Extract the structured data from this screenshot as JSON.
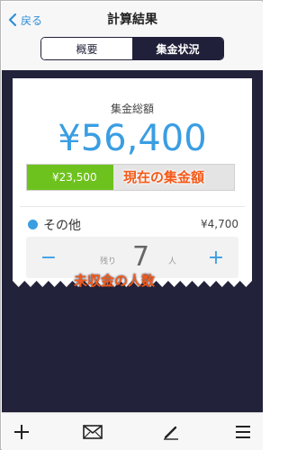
{
  "nav": {
    "back_label": "戻る",
    "title": "計算結果"
  },
  "tabs": [
    {
      "label": "概要",
      "selected": false
    },
    {
      "label": "集金状況",
      "selected": true
    }
  ],
  "summary": {
    "total_label": "集金総額",
    "total_amount": "¥56,400",
    "collected_amount": "¥23,500",
    "collected_fraction": 0.417
  },
  "annotations": {
    "current": "現在の集金額",
    "unpaid": "未収金の人数"
  },
  "member": {
    "name": "その他",
    "amount": "¥4,700",
    "remaining_label": "残り",
    "remaining_count": "7",
    "unit_label": "人",
    "minus_label": "−",
    "plus_label": "+"
  },
  "colors": {
    "accent": "#3a9ee2",
    "progress": "#6ec21e",
    "annotation": "#f25a1a",
    "dark_bg": "#22223a"
  },
  "toolbar": {
    "icons": [
      "add-icon",
      "mail-icon",
      "edit-icon",
      "menu-icon"
    ]
  }
}
